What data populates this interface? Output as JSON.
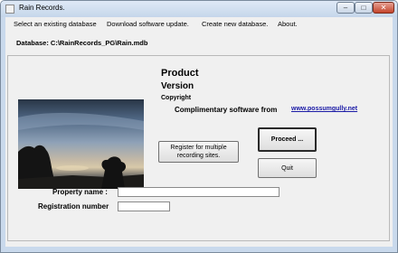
{
  "window": {
    "title": "Rain Records.",
    "controls": {
      "minimize": "–",
      "maximize": "□",
      "close": "✕"
    }
  },
  "menu": {
    "items": [
      {
        "label": "Select an existing database"
      },
      {
        "label": "Download software update."
      },
      {
        "label": "Create new database."
      },
      {
        "label": "About."
      }
    ]
  },
  "database": {
    "path_text": "Database: C:\\RainRecords_PG\\Rain.mdb"
  },
  "product": {
    "title": "Product",
    "version_label": "Version",
    "copyright_label": "Copyright",
    "complimentary_text": "Complimentary software from",
    "website": "www.possumgully.net"
  },
  "buttons": {
    "register_multiple": "Register for multiple recording sites.",
    "proceed": "Proceed ...",
    "quit": "Quit"
  },
  "form": {
    "property_label": "Property name :",
    "property_value": "",
    "registration_label": "Registration number",
    "registration_value": ""
  },
  "icons": {
    "app": "app-icon",
    "minimize": "minimize-icon",
    "maximize": "maximize-icon",
    "close": "close-icon",
    "photo": "sunset-tree-photo"
  },
  "colors": {
    "frame": "#c9d9ec",
    "client_bg": "#f0f0f0",
    "link": "#1a1aa6",
    "close_button": "#c4442b"
  }
}
